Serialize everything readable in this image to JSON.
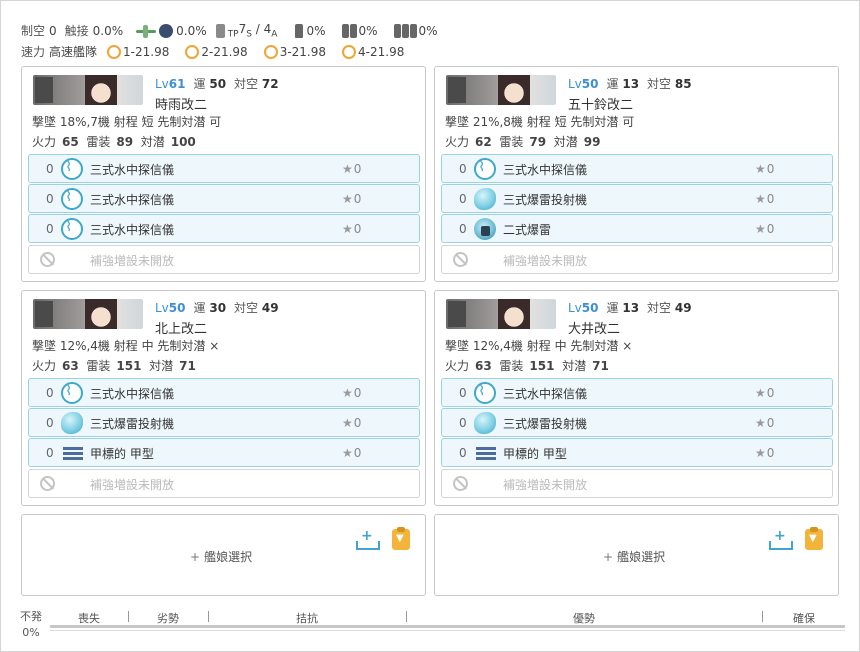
{
  "summary": {
    "air_label": "制空",
    "air_value": "0",
    "contact_label": "触接",
    "contact_value": "0.0%",
    "plane_rate": "0.0%",
    "sub_rate": "",
    "tp_text": "TP",
    "tp_s": "7",
    "tp_s_sub": "S",
    "tp_sep": " / ",
    "tp_a": "4",
    "tp_a_sub": "A",
    "bottle_rate": "0%",
    "drum2_rate": "0%",
    "drum3_rate": "0%",
    "speed_label": "速力",
    "speed_value": "高速艦隊",
    "contacts": [
      {
        "label": "1-21.98"
      },
      {
        "label": "2-21.98"
      },
      {
        "label": "3-21.98"
      },
      {
        "label": "4-21.98"
      }
    ]
  },
  "ships": [
    {
      "lv_prefix": "Lv",
      "lv": "61",
      "luck_label": "運",
      "luck": "50",
      "asw_label": "対空",
      "asw": "72",
      "name": "時雨改二",
      "stat1": "撃墜 18%,7機  射程 短  先制対潜 可",
      "stat2_fp_label": "火力",
      "stat2_fp": "65",
      "stat2_tp_label": "雷装",
      "stat2_tp": "89",
      "stat2_as_label": "対潜",
      "stat2_as": "100",
      "slots": [
        {
          "count": "0",
          "icon": "sonar",
          "name": "三式水中探信儀",
          "star": "★",
          "level": "0"
        },
        {
          "count": "0",
          "icon": "sonar",
          "name": "三式水中探信儀",
          "star": "★",
          "level": "0"
        },
        {
          "count": "0",
          "icon": "sonar",
          "name": "三式水中探信儀",
          "star": "★",
          "level": "0"
        }
      ],
      "ex_label": "補強増設未開放"
    },
    {
      "lv_prefix": "Lv",
      "lv": "50",
      "luck_label": "運",
      "luck": "13",
      "asw_label": "対空",
      "asw": "85",
      "name": "五十鈴改二",
      "stat1": "撃墜 21%,8機  射程 短  先制対潜 可",
      "stat2_fp_label": "火力",
      "stat2_fp": "62",
      "stat2_tp_label": "雷装",
      "stat2_tp": "79",
      "stat2_as_label": "対潜",
      "stat2_as": "99",
      "slots": [
        {
          "count": "0",
          "icon": "sonar",
          "name": "三式水中探信儀",
          "star": "★",
          "level": "0"
        },
        {
          "count": "0",
          "icon": "dcp",
          "name": "三式爆雷投射機",
          "star": "★",
          "level": "0"
        },
        {
          "count": "0",
          "icon": "dc",
          "name": "二式爆雷",
          "star": "★",
          "level": "0"
        }
      ],
      "ex_label": "補強増設未開放"
    },
    {
      "lv_prefix": "Lv",
      "lv": "50",
      "luck_label": "運",
      "luck": "30",
      "asw_label": "対空",
      "asw": "49",
      "name": "北上改二",
      "stat1": "撃墜 12%,4機  射程 中  先制対潜 ×",
      "stat2_fp_label": "火力",
      "stat2_fp": "63",
      "stat2_tp_label": "雷装",
      "stat2_tp": "151",
      "stat2_as_label": "対潜",
      "stat2_as": "71",
      "slots": [
        {
          "count": "0",
          "icon": "sonar",
          "name": "三式水中探信儀",
          "star": "★",
          "level": "0"
        },
        {
          "count": "0",
          "icon": "dcp",
          "name": "三式爆雷投射機",
          "star": "★",
          "level": "0"
        },
        {
          "count": "0",
          "icon": "kou",
          "name": "甲標的 甲型",
          "star": "★",
          "level": "0"
        }
      ],
      "ex_label": "補強増設未開放"
    },
    {
      "lv_prefix": "Lv",
      "lv": "50",
      "luck_label": "運",
      "luck": "13",
      "asw_label": "対空",
      "asw": "49",
      "name": "大井改二",
      "stat1": "撃墜 12%,4機  射程 中  先制対潜 ×",
      "stat2_fp_label": "火力",
      "stat2_fp": "63",
      "stat2_tp_label": "雷装",
      "stat2_tp": "151",
      "stat2_as_label": "対潜",
      "stat2_as": "71",
      "slots": [
        {
          "count": "0",
          "icon": "sonar",
          "name": "三式水中探信儀",
          "star": "★",
          "level": "0"
        },
        {
          "count": "0",
          "icon": "dcp",
          "name": "三式爆雷投射機",
          "star": "★",
          "level": "0"
        },
        {
          "count": "0",
          "icon": "kou",
          "name": "甲標的 甲型",
          "star": "★",
          "level": "0"
        }
      ],
      "ex_label": "補強増設未開放"
    }
  ],
  "empty_slots": [
    {
      "label": "艦娘選択",
      "plus": "+"
    },
    {
      "label": "艦娘選択",
      "plus": "+"
    }
  ],
  "bottom": {
    "left_label": "不発",
    "left_value": "0%",
    "bar_labels": [
      "喪失",
      "劣勢",
      "拮抗",
      "優勢",
      "確保"
    ]
  }
}
